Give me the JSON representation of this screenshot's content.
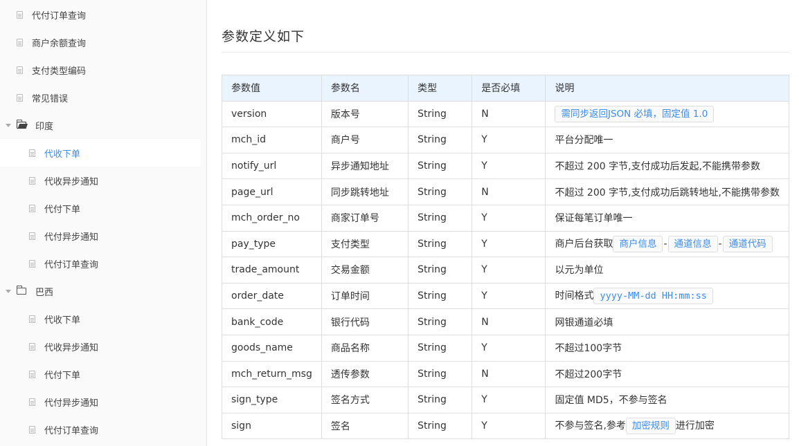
{
  "sidebar": {
    "items": [
      {
        "label": "代付订单查询",
        "type": "doc",
        "level": 1
      },
      {
        "label": "商户余额查询",
        "type": "doc",
        "level": 1
      },
      {
        "label": "支付类型编码",
        "type": "doc",
        "level": 1
      },
      {
        "label": "常见错误",
        "type": "doc",
        "level": 1
      },
      {
        "label": "印度",
        "type": "folder-open",
        "level": 0
      },
      {
        "label": "代收下单",
        "type": "doc",
        "level": 2,
        "active": true
      },
      {
        "label": "代收异步通知",
        "type": "doc",
        "level": 2
      },
      {
        "label": "代付下单",
        "type": "doc",
        "level": 2
      },
      {
        "label": "代付异步通知",
        "type": "doc",
        "level": 2
      },
      {
        "label": "代付订单查询",
        "type": "doc",
        "level": 2
      },
      {
        "label": "巴西",
        "type": "folder",
        "level": 0
      },
      {
        "label": "代收下单",
        "type": "doc",
        "level": 2
      },
      {
        "label": "代收异步通知",
        "type": "doc",
        "level": 2
      },
      {
        "label": "代付下单",
        "type": "doc",
        "level": 2
      },
      {
        "label": "代付异步通知",
        "type": "doc",
        "level": 2
      },
      {
        "label": "代付订单查询",
        "type": "doc",
        "level": 2
      }
    ],
    "active_color": "#3b8ced"
  },
  "main": {
    "heading": "参数定义如下",
    "table": {
      "headers": [
        "参数值",
        "参数名",
        "类型",
        "是否必填",
        "说明"
      ],
      "rows": [
        {
          "value": "version",
          "name": "版本号",
          "type": "String",
          "required": "N",
          "desc": "",
          "codes": [
            "需同步返回JSON 必填，固定值 1.0"
          ]
        },
        {
          "value": "mch_id",
          "name": "商户号",
          "type": "String",
          "required": "Y",
          "desc": "平台分配唯一"
        },
        {
          "value": "notify_url",
          "name": "异步通知地址",
          "type": "String",
          "required": "Y",
          "desc": "不超过 200 字节,支付成功后发起,不能携带参数"
        },
        {
          "value": "page_url",
          "name": "同步跳转地址",
          "type": "String",
          "required": "N",
          "desc": "不超过 200 字节,支付成功后跳转地址,不能携带参数"
        },
        {
          "value": "mch_order_no",
          "name": "商家订单号",
          "type": "String",
          "required": "Y",
          "desc": "保证每笔订单唯一"
        },
        {
          "value": "pay_type",
          "name": "支付类型",
          "type": "String",
          "required": "Y",
          "desc": "商户后台获取",
          "codes": [
            "商户信息",
            "通道信息",
            "通道代码"
          ],
          "separator": "-"
        },
        {
          "value": "trade_amount",
          "name": "交易金额",
          "type": "String",
          "required": "Y",
          "desc": "以元为单位"
        },
        {
          "value": "order_date",
          "name": "订单时间",
          "type": "String",
          "required": "Y",
          "desc": "时间格式",
          "codes": [
            "yyyy-MM-dd HH:mm:ss"
          ]
        },
        {
          "value": "bank_code",
          "name": "银行代码",
          "type": "String",
          "required": "N",
          "desc": "网银通道必填"
        },
        {
          "value": "goods_name",
          "name": "商品名称",
          "type": "String",
          "required": "Y",
          "desc": "不超过100字节"
        },
        {
          "value": "mch_return_msg",
          "name": "透传参数",
          "type": "String",
          "required": "N",
          "desc": "不超过200字节"
        },
        {
          "value": "sign_type",
          "name": "签名方式",
          "type": "String",
          "required": "Y",
          "desc": "固定值 MD5，不参与签名"
        },
        {
          "value": "sign",
          "name": "签名",
          "type": "String",
          "required": "Y",
          "desc": "不参与签名,参考",
          "codes": [
            "加密规则"
          ],
          "desc_suffix": "进行加密"
        }
      ]
    },
    "header_bg": "#eaf4ff",
    "code_color": "#3b8ced"
  }
}
